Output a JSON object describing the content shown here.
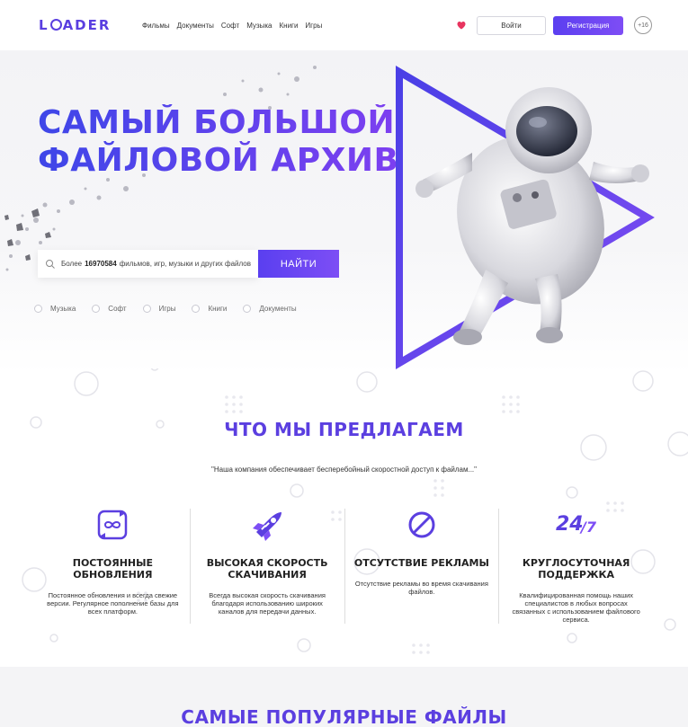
{
  "header": {
    "logo": "L",
    "logo_rest": "ADER",
    "nav": [
      "Фильмы",
      "Документы",
      "Софт",
      "Музыка",
      "Книги",
      "Игры"
    ],
    "favorites_icon": "heart-icon",
    "login_label": "Войти",
    "register_label": "Регистрация",
    "age_badge": "+16"
  },
  "hero": {
    "title_line1": "САМЫЙ БОЛЬШОЙ",
    "title_line2": "ФАЙЛОВОЙ АРХИВ",
    "search": {
      "prefix": "Более",
      "count": "16970584",
      "suffix": "фильмов, игр, музыки и других файлов"
    },
    "find_label": "НАЙТИ",
    "categories": [
      "Музыка",
      "Софт",
      "Игры",
      "Книги",
      "Документы"
    ]
  },
  "offer": {
    "title": "ЧТО МЫ ПРЕДЛАГАЕМ",
    "subtitle": "\"Наша компания обеспечивает бесперебойный скоростной доступ к файлам...\"",
    "features": [
      {
        "icon": "infinity-refresh-icon",
        "title": "ПОСТОЯННЫЕ ОБНОВЛЕНИЯ",
        "text": "Постоянное обновления и всегда свежие версии. Регулярное пополнение базы для всех платформ."
      },
      {
        "icon": "rocket-icon",
        "title": "ВЫСОКАЯ СКОРОСТЬ СКАЧИВАНИЯ",
        "text": "Всегда высокая скорость скачивания благодаря использованию широких каналов для передачи данных."
      },
      {
        "icon": "no-ads-icon",
        "title": "ОТСУТСТВИЕ РЕКЛАМЫ",
        "text": "Отсутствие рекламы во время скачивания файлов."
      },
      {
        "icon": "24-7-icon",
        "title": "КРУГЛОСУТОЧНАЯ ПОДДЕРЖКА",
        "text": "Квалифицированная помощь наших специалистов в любых вопросах связанных с использованием файлового сервиса."
      }
    ]
  },
  "popular": {
    "title": "САМЫЕ ПОПУЛЯРНЫЕ ФАЙЛЫ"
  },
  "colors": {
    "accent": "#5b3fe0",
    "accent2": "#7d4ef5",
    "heart": "#e8345f"
  }
}
